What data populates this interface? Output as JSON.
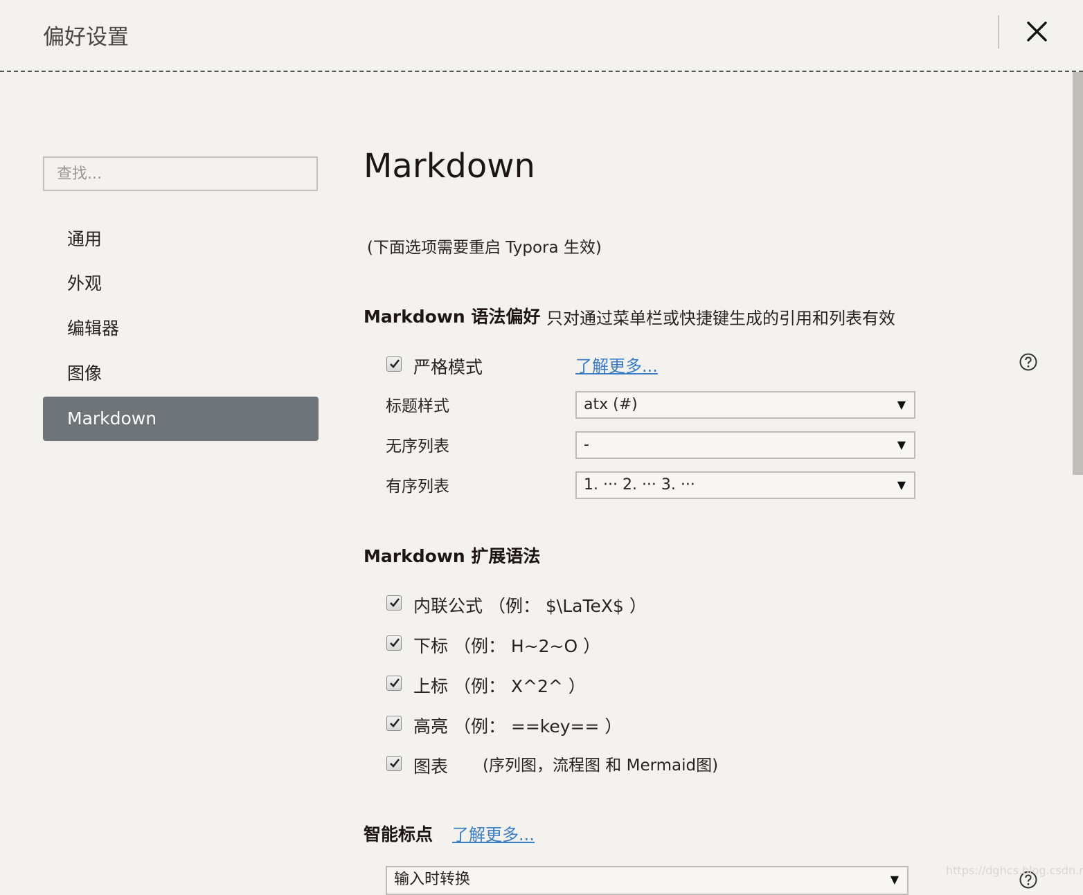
{
  "window": {
    "title": "偏好设置",
    "close_icon": "close-icon"
  },
  "sidebar": {
    "search_placeholder": "查找...",
    "items": [
      {
        "label": "通用",
        "active": false
      },
      {
        "label": "外观",
        "active": false
      },
      {
        "label": "编辑器",
        "active": false
      },
      {
        "label": "图像",
        "active": false
      },
      {
        "label": "Markdown",
        "active": true
      }
    ]
  },
  "main": {
    "title": "Markdown",
    "restart_note": "(下面选项需要重启 Typora 生效)",
    "syntax_pref": {
      "heading": "Markdown 语法偏好",
      "desc": "只对通过菜单栏或快捷键生成的引用和列表有效",
      "strict_mode": {
        "label": "严格模式",
        "checked": true,
        "learn_more": "了解更多..."
      },
      "heading_style": {
        "label": "标题样式",
        "value": "atx (#)"
      },
      "unordered_list": {
        "label": "无序列表",
        "value": "-"
      },
      "ordered_list": {
        "label": "有序列表",
        "value": "1. ··· 2. ··· 3. ···"
      }
    },
    "extended_syntax": {
      "heading": "Markdown 扩展语法",
      "options": [
        {
          "label": "内联公式 （例： $\\LaTeX$ ）",
          "checked": true
        },
        {
          "label": "下标 （例： H~2~O ）",
          "checked": true
        },
        {
          "label": "上标 （例： X^2^ ）",
          "checked": true
        },
        {
          "label": "高亮 （例： ==key== ）",
          "checked": true
        },
        {
          "label": "图表",
          "checked": true,
          "note": "(序列图，流程图 和 Mermaid图)"
        }
      ]
    },
    "smart_punct": {
      "heading": "智能标点",
      "learn_more": "了解更多...",
      "value": "输入时转换"
    }
  },
  "watermark": "https://dghcs.blog.csdn.net",
  "colors": {
    "accent_link": "#3a7dc4",
    "active_nav_bg": "#6f7478",
    "background": "#f4f2ee"
  }
}
